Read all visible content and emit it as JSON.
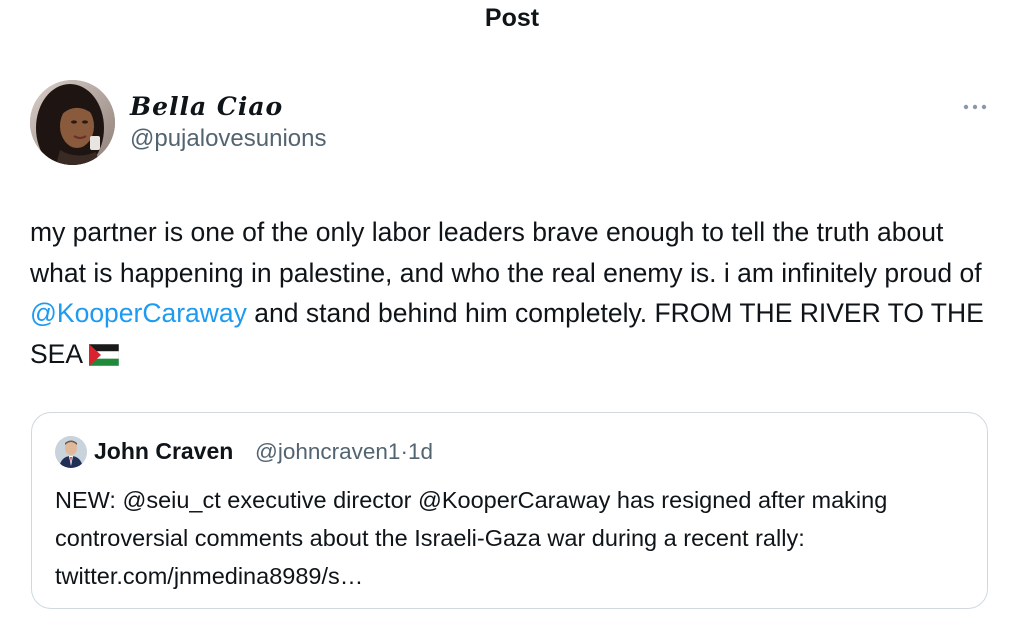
{
  "header": {
    "title": "Post"
  },
  "post": {
    "author": {
      "display_name": "𝑩𝒆𝒍𝒍𝒂 𝑪𝒊𝒂𝒐",
      "handle": "@pujalovesunions"
    },
    "text_part1": "my partner is one of the only labor leaders brave enough to tell the truth about what is happening in palestine, and who the real enemy is. i am infinitely proud of ",
    "mention": "@KooperCaraway",
    "text_part2": " and stand behind him completely. FROM THE RIVER TO THE SEA",
    "flag_icon": "palestine-flag-emoji"
  },
  "quote": {
    "author": {
      "display_name": "John Craven",
      "handle": "@johncraven1",
      "separator": "·",
      "time": "1d"
    },
    "text": "NEW: @seiu_ct executive director @KooperCaraway has resigned after making controversial comments about the Israeli-Gaza war during a recent rally: twitter.com/jnmedina8989/s…"
  },
  "colors": {
    "text": "#0f1419",
    "secondary": "#536471",
    "link": "#1d9bf0",
    "border": "#cfd9de"
  }
}
